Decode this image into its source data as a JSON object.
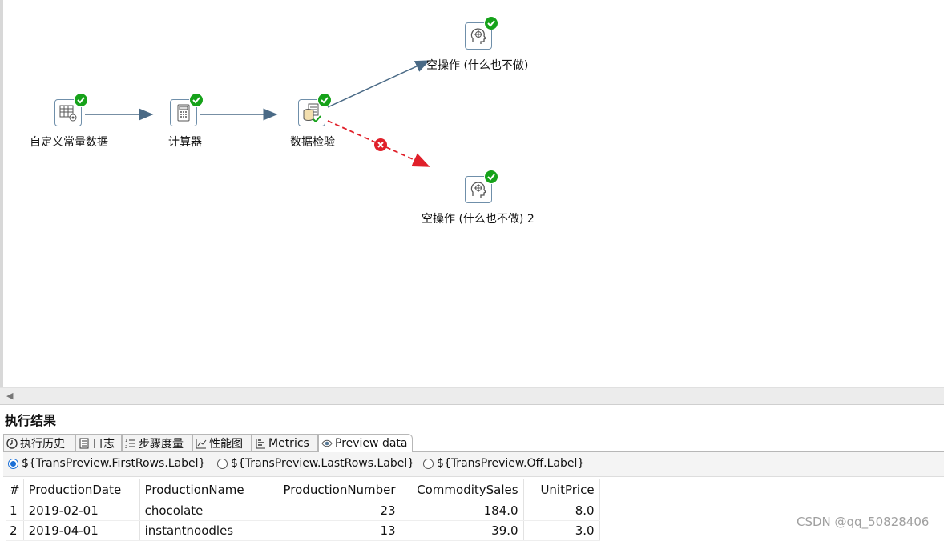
{
  "canvas": {
    "steps": [
      {
        "id": "s1",
        "label": "自定义常量数据",
        "icon": "data-grid-icon"
      },
      {
        "id": "s2",
        "label": "计算器",
        "icon": "calculator-icon"
      },
      {
        "id": "s3",
        "label": "数据检验",
        "icon": "validator-icon"
      },
      {
        "id": "s4",
        "label": "空操作 (什么也不做)",
        "icon": "dummy-head-icon"
      },
      {
        "id": "s5",
        "label": "空操作 (什么也不做) 2",
        "icon": "dummy-head-icon"
      }
    ],
    "colors": {
      "hop": "#4a6a86",
      "error_hop": "#e0202a",
      "ok_badge": "#16a21a"
    }
  },
  "panel": {
    "title": "执行结果",
    "tabs": [
      {
        "label": "执行历史",
        "icon": "history-icon"
      },
      {
        "label": "日志",
        "icon": "log-icon"
      },
      {
        "label": "步骤度量",
        "icon": "step-metrics-icon"
      },
      {
        "label": "性能图",
        "icon": "performance-chart-icon"
      },
      {
        "label": "Metrics",
        "icon": "metrics-icon"
      },
      {
        "label": "Preview data",
        "icon": "eye-icon",
        "active": true
      }
    ],
    "preview_options": [
      {
        "label": "${TransPreview.FirstRows.Label}",
        "selected": true
      },
      {
        "label": "${TransPreview.LastRows.Label}",
        "selected": false
      },
      {
        "label": "${TransPreview.Off.Label}",
        "selected": false
      }
    ],
    "table": {
      "headers": [
        "#",
        "ProductionDate",
        "ProductionName",
        "ProductionNumber",
        "CommoditySales",
        "UnitPrice"
      ],
      "rows": [
        [
          "1",
          "2019-02-01",
          "chocolate",
          "23",
          "184.0",
          "8.0"
        ],
        [
          "2",
          "2019-04-01",
          "instantnoodles",
          "13",
          "39.0",
          "3.0"
        ]
      ]
    }
  },
  "watermark": "CSDN @qq_50828406"
}
